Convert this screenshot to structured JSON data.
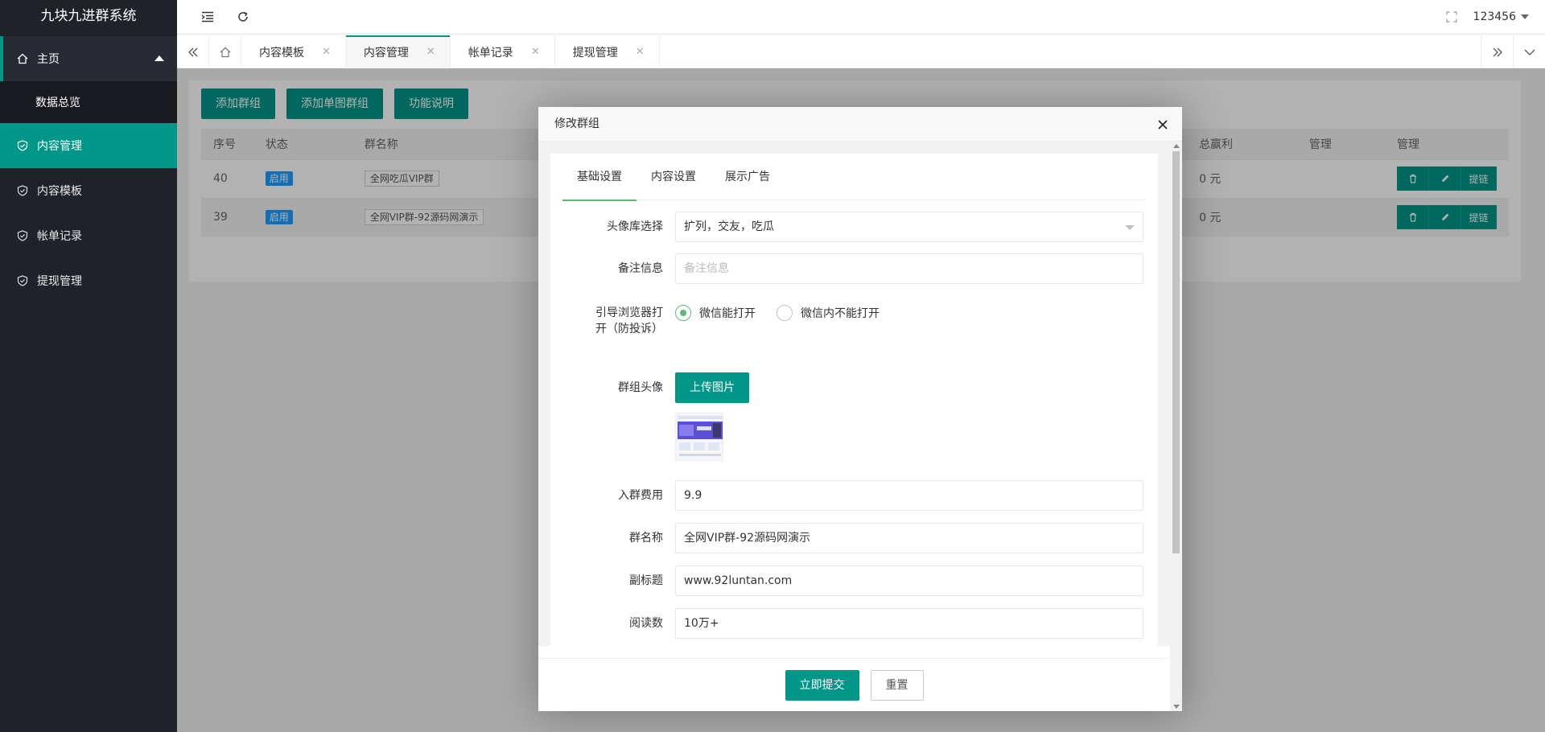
{
  "app": {
    "title": "九块九进群系统"
  },
  "sidebar": {
    "home": "主页",
    "sub": "数据总览",
    "items": [
      {
        "label": "内容管理",
        "active": true
      },
      {
        "label": "内容模板"
      },
      {
        "label": "帐单记录"
      },
      {
        "label": "提现管理"
      }
    ]
  },
  "header": {
    "user": "123456"
  },
  "tabs": [
    {
      "label": "内容模板"
    },
    {
      "label": "内容管理",
      "current": true
    },
    {
      "label": "帐单记录"
    },
    {
      "label": "提现管理"
    }
  ],
  "toolbar": {
    "add_group": "添加群组",
    "add_single": "添加单图群组",
    "help": "功能说明"
  },
  "table": {
    "headers": {
      "id": "序号",
      "status": "状态",
      "name": "群名称",
      "profit": "总赢利",
      "manage1": "管理",
      "manage2": "管理"
    },
    "rows": [
      {
        "id": "40",
        "status": "启用",
        "name": "全网吃瓜VIP群",
        "profit": "0 元"
      },
      {
        "id": "39",
        "status": "启用",
        "name": "全网VIP群-92源码网演示",
        "profit": "0 元"
      }
    ],
    "op_text": "提链"
  },
  "modal": {
    "title": "修改群组",
    "tabs": [
      "基础设置",
      "内容设置",
      "展示广告"
    ],
    "fields": {
      "avatar_lib_label": "头像库选择",
      "avatar_lib_value": "扩列，交友，吃瓜",
      "remark_label": "备注信息",
      "remark_placeholder": "备注信息",
      "browser_label": "引导浏览器打开（防投诉）",
      "browser_opt1": "微信能打开",
      "browser_opt2": "微信内不能打开",
      "avatar_label": "群组头像",
      "upload_btn": "上传图片",
      "fee_label": "入群费用",
      "fee_value": "9.9",
      "name_label": "群名称",
      "name_value": "全网VIP群-92源码网演示",
      "subtitle_label": "副标题",
      "subtitle_value": "www.92luntan.com",
      "reads_label": "阅读数",
      "reads_value": "10万+"
    },
    "submit": "立即提交",
    "reset": "重置"
  }
}
